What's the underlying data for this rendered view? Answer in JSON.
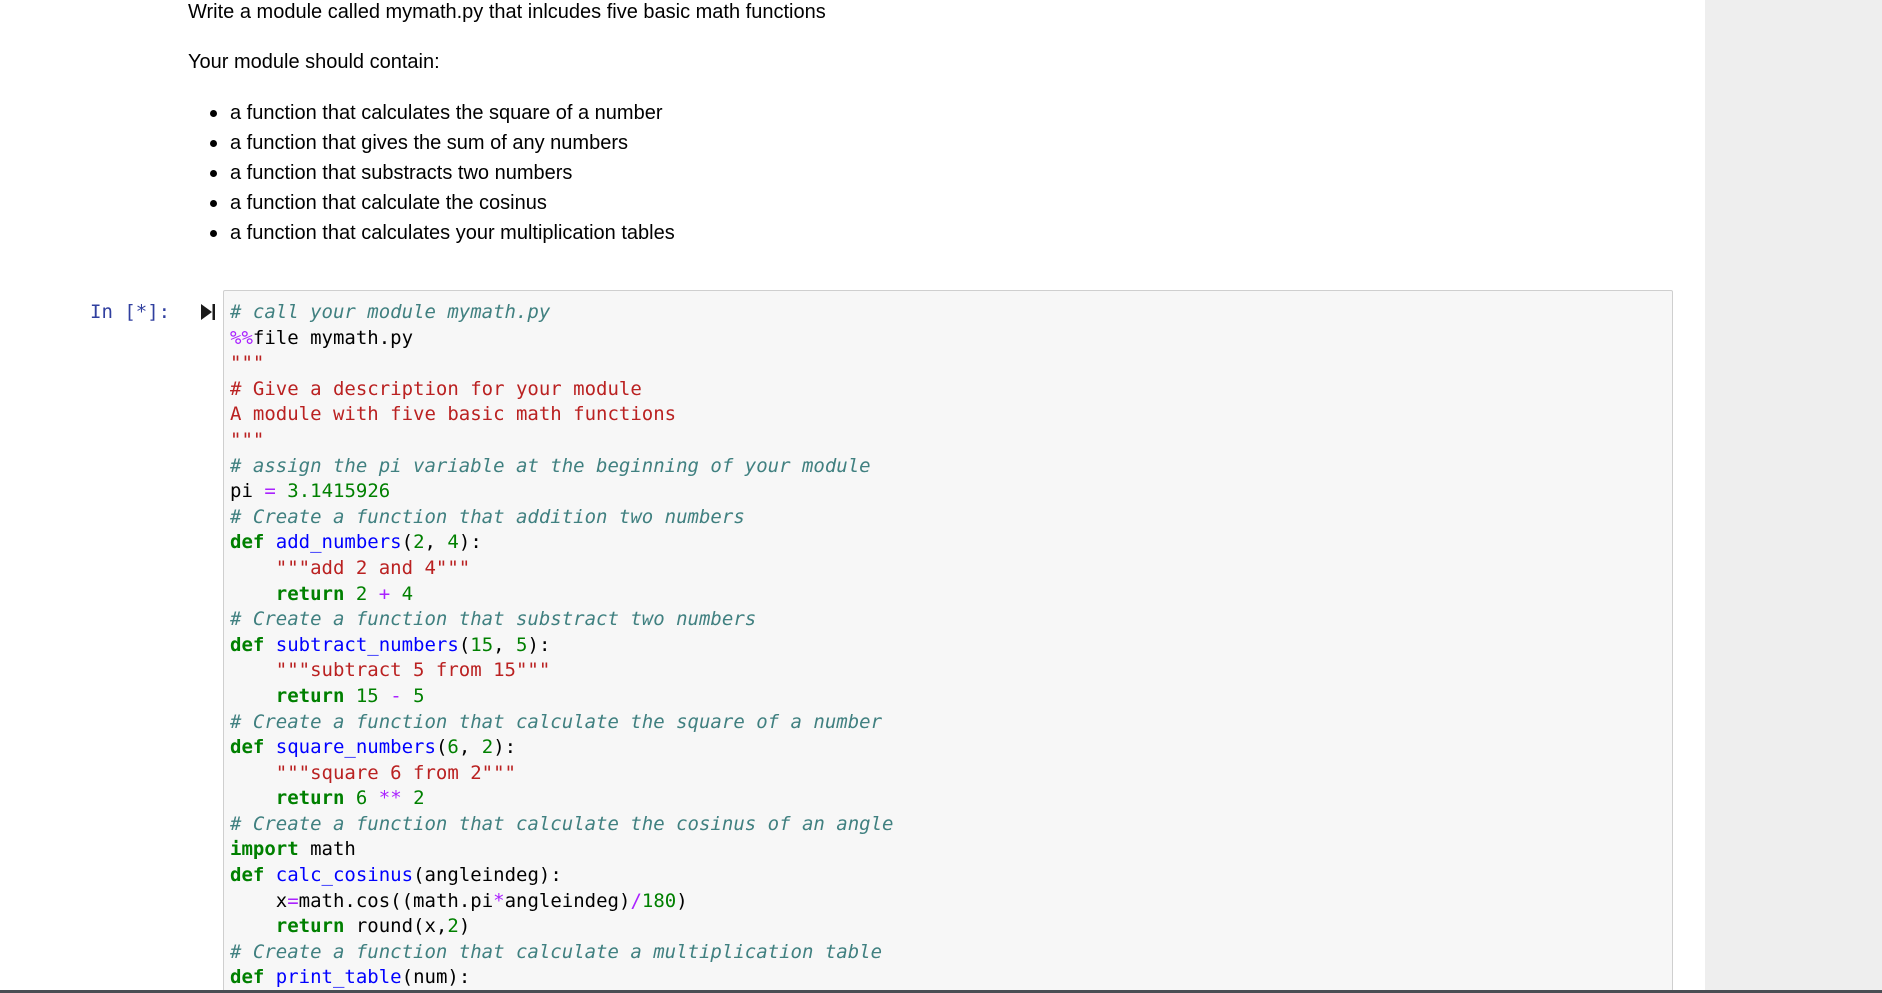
{
  "markdown": {
    "heading": "Write a module called mymath.py that inlcudes five basic math functions",
    "intro": "Your module should contain:",
    "items": [
      "a function that calculates the square of a number",
      "a function that gives the sum of any numbers",
      "a function that substracts two numbers",
      "a function that calculate the cosinus",
      "a function that calculates your multiplication tables"
    ]
  },
  "cell": {
    "prompt": "In [*]:",
    "run_icon": "run-cell-icon"
  },
  "code": {
    "l1": "# call your module mymath.py",
    "l2_magic": "%%",
    "l2_rest": "file mymath.py",
    "l3": "\"\"\"",
    "l4": "# Give a description for your module",
    "l5": "A module with five basic math functions",
    "l6": "\"\"\"",
    "l7": "# assign the pi variable at the beginning of your module",
    "l8_name": "pi",
    "l8_eq": "=",
    "l8_val": "3.1415926",
    "l9": "# Create a function that addition two numbers",
    "l10_def": "def",
    "l10_fn": "add_numbers",
    "l10_a": "(",
    "l10_n1": "2",
    "l10_b": ", ",
    "l10_n2": "4",
    "l10_c": "):",
    "l11": "\"\"\"add 2 and 4\"\"\"",
    "l12_kw": "return",
    "l12_n1": "2",
    "l12_op": "+",
    "l12_n2": "4",
    "l13": "# Create a function that substract two numbers",
    "l14_def": "def",
    "l14_fn": "subtract_numbers",
    "l14_a": "(",
    "l14_n1": "15",
    "l14_b": ", ",
    "l14_n2": "5",
    "l14_c": "):",
    "l15": "\"\"\"subtract 5 from 15\"\"\"",
    "l16_kw": "return",
    "l16_n1": "15",
    "l16_op": "-",
    "l16_n2": "5",
    "l17": "# Create a function that calculate the square of a number",
    "l18_def": "def",
    "l18_fn": "square_numbers",
    "l18_a": "(",
    "l18_n1": "6",
    "l18_b": ", ",
    "l18_n2": "2",
    "l18_c": "):",
    "l19": "\"\"\"square 6 from 2\"\"\"",
    "l20_kw": "return",
    "l20_n1": "6",
    "l20_op": "**",
    "l20_n2": "2",
    "l21": "# Create a function that calculate the cosinus of an angle",
    "l22_kw": "import",
    "l22_rest": "math",
    "l23_def": "def",
    "l23_fn": "calc_cosinus",
    "l23_rest": "(angleindeg):",
    "l24_a": "x",
    "l24_eq": "=",
    "l24_b": "math.cos((math.pi",
    "l24_mul": "*",
    "l24_c": "angleindeg)",
    "l24_div": "/",
    "l24_n": "180",
    "l24_d": ")",
    "l25_kw": "return",
    "l25_a": "round(x,",
    "l25_n": "2",
    "l25_b": ")",
    "l26": "# Create a function that calculate a multiplication table",
    "l27_def": "def",
    "l27_fn": "print_table",
    "l27_rest": "(num):"
  }
}
